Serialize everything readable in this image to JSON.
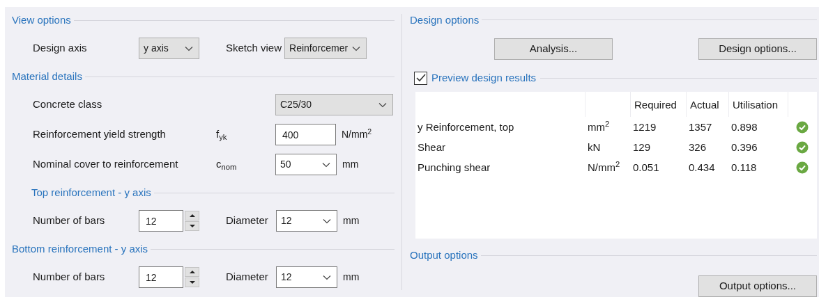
{
  "left": [
    {
      "kind": "heading",
      "title": "View options"
    },
    {
      "kind": "field",
      "label": "Design axis",
      "control": {
        "kind": "select",
        "value": "y axis"
      },
      "second": {
        "label": "Sketch view",
        "control": {
          "kind": "select",
          "value": "Reinforcemer"
        }
      }
    },
    {
      "kind": "heading",
      "title": "Material details"
    },
    {
      "kind": "field",
      "label": "Concrete class",
      "control": {
        "kind": "wideselect",
        "value": "C25/30"
      }
    },
    {
      "kind": "field",
      "label": "Reinforcement yield strength",
      "symbol": "f$_{yk}$",
      "control": {
        "kind": "input",
        "value": "400"
      },
      "unit": "N/mm$^{2}$"
    },
    {
      "kind": "field",
      "label": "Nominal cover to reinforcement",
      "symbol": "c$_{nom}$",
      "control": {
        "kind": "whiteselect",
        "value": "50"
      },
      "unit": "mm"
    },
    {
      "kind": "subheading",
      "title": "Top reinforcement - y axis"
    },
    {
      "kind": "field",
      "label": "Number of bars",
      "control": {
        "kind": "spinner",
        "value": "12"
      },
      "second": {
        "label": "Diameter",
        "control": {
          "kind": "whiteselect",
          "value": "12"
        },
        "unit": "mm"
      }
    },
    {
      "kind": "heading",
      "title": "Bottom reinforcement - y axis"
    },
    {
      "kind": "field",
      "label": "Number of bars",
      "control": {
        "kind": "spinner",
        "value": "12"
      },
      "second": {
        "label": "Diameter",
        "control": {
          "kind": "whiteselect",
          "value": "12"
        },
        "unit": "mm"
      }
    }
  ],
  "design_options": {
    "title": "Design options",
    "buttons": [
      "Analysis...",
      "Design options..."
    ]
  },
  "preview": {
    "label": "Preview design results",
    "checked": true,
    "columns": [
      "Required",
      "Actual",
      "Utilisation"
    ],
    "rows": [
      {
        "name": "y Reinforcement, top",
        "unit": "mm$^{2}$",
        "required": "1219",
        "actual": "1357",
        "utilisation": "0.898",
        "passed": true
      },
      {
        "name": "Shear",
        "unit": "kN",
        "required": "129",
        "actual": "326",
        "utilisation": "0.396",
        "passed": true
      },
      {
        "name": "Punching shear",
        "unit": "N/mm$^{2}$",
        "required": "0.051",
        "actual": "0.434",
        "utilisation": "0.118",
        "passed": true
      }
    ]
  },
  "output_options": {
    "title": "Output options",
    "button": "Output options..."
  }
}
